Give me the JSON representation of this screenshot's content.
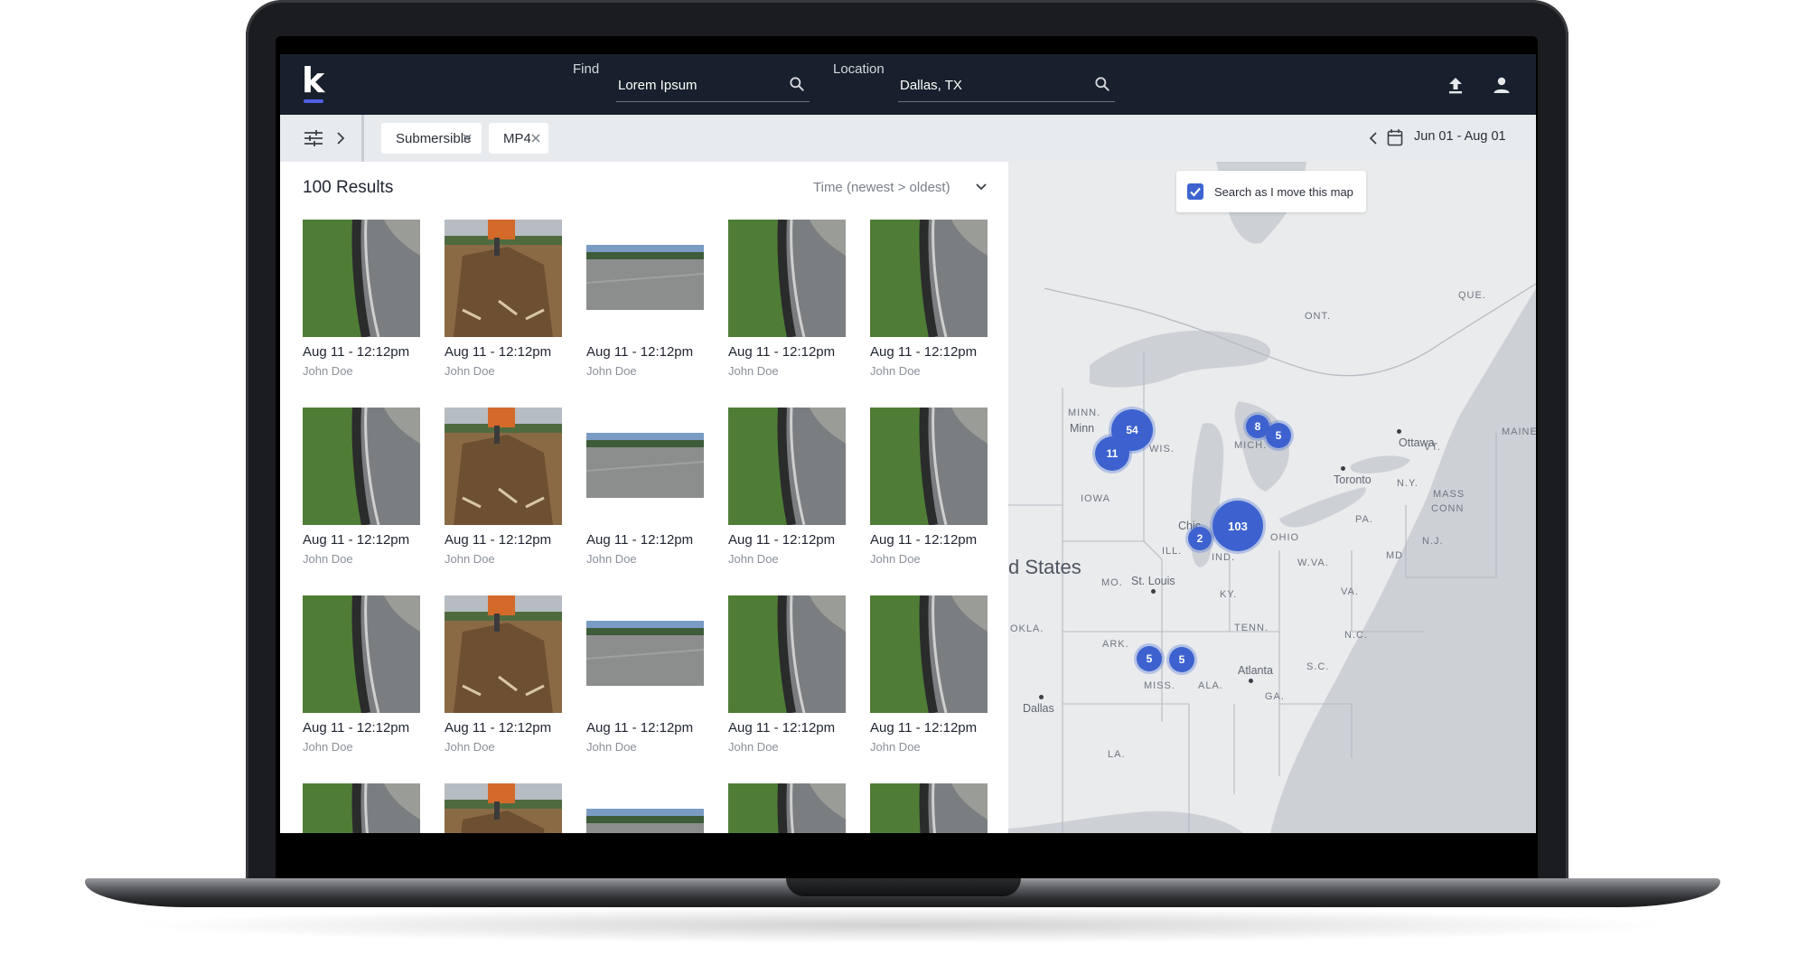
{
  "app": {
    "logo_text": "k",
    "accent_color": "#4f5fe6"
  },
  "header": {
    "find_label": "Find",
    "find_value": "Lorem Ipsum",
    "location_label": "Location",
    "location_value": "Dallas, TX",
    "icons": [
      "search-icon",
      "upload-icon",
      "user-icon"
    ]
  },
  "filters": {
    "chips": [
      {
        "label": "Submersible"
      },
      {
        "label": "MP4"
      }
    ],
    "date_range": "Jun 01 - Aug 01"
  },
  "results": {
    "count_label": "100 Results",
    "sort_label": "Time (newest > oldest)",
    "items": [
      {
        "type": "road",
        "date": "Aug 11 - 12:12pm",
        "user": "John Doe"
      },
      {
        "type": "dig",
        "date": "Aug 11 - 12:12pm",
        "user": "John Doe"
      },
      {
        "type": "field",
        "date": "Aug 11 - 12:12pm",
        "user": "John Doe"
      },
      {
        "type": "road",
        "date": "Aug 11 - 12:12pm",
        "user": "John Doe"
      },
      {
        "type": "road",
        "date": "Aug 11 - 12:12pm",
        "user": "John Doe"
      },
      {
        "type": "road",
        "date": "Aug 11 - 12:12pm",
        "user": "John Doe"
      },
      {
        "type": "dig",
        "date": "Aug 11 - 12:12pm",
        "user": "John Doe"
      },
      {
        "type": "field",
        "date": "Aug 11 - 12:12pm",
        "user": "John Doe"
      },
      {
        "type": "road",
        "date": "Aug 11 - 12:12pm",
        "user": "John Doe"
      },
      {
        "type": "road",
        "date": "Aug 11 - 12:12pm",
        "user": "John Doe"
      },
      {
        "type": "road",
        "date": "Aug 11 - 12:12pm",
        "user": "John Doe"
      },
      {
        "type": "dig",
        "date": "Aug 11 - 12:12pm",
        "user": "John Doe"
      },
      {
        "type": "field",
        "date": "Aug 11 - 12:12pm",
        "user": "John Doe"
      },
      {
        "type": "road",
        "date": "Aug 11 - 12:12pm",
        "user": "John Doe"
      },
      {
        "type": "road",
        "date": "Aug 11 - 12:12pm",
        "user": "John Doe"
      },
      {
        "type": "road",
        "date": "",
        "user": ""
      },
      {
        "type": "dig",
        "date": "",
        "user": ""
      },
      {
        "type": "field",
        "date": "",
        "user": ""
      },
      {
        "type": "road",
        "date": "",
        "user": ""
      },
      {
        "type": "road",
        "date": "",
        "user": ""
      }
    ]
  },
  "map": {
    "search_as_move_label": "Search as I move this map",
    "search_as_move_checked": true,
    "clusters": [
      "54",
      "11",
      "8",
      "5",
      "2",
      "103",
      "5",
      "5"
    ],
    "region_labels": [
      "QUE.",
      "ONT.",
      "MINN.",
      "WIS.",
      "MICH.",
      "IOWA",
      "ILL.",
      "IND.",
      "OHIO",
      "MO.",
      "KY.",
      "W.VA.",
      "VA.",
      "PA.",
      "N.Y.",
      "VT.",
      "MAINE",
      "MASS",
      "CONN",
      "N.J.",
      "MD",
      "TENN.",
      "N.C.",
      "S.C.",
      "ARK.",
      "OKLA.",
      "MISS.",
      "ALA.",
      "GA.",
      "LA."
    ],
    "city_labels": [
      "Minn",
      "Chic",
      "Toronto",
      "Ottawa",
      "St. Louis",
      "Atlanta",
      "Dallas"
    ],
    "country_label": "d States"
  }
}
